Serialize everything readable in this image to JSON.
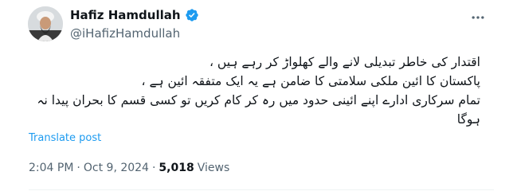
{
  "author": {
    "display_name": "Hafiz Hamdullah",
    "handle": "@iHafizHamdullah",
    "verified_icon": "verified-badge-icon",
    "verified_color": "#1d9bf0"
  },
  "post": {
    "lines": [
      "اقتدار کی خاطر تبدیلی لانے والے کھلواڑ کر رہے ہیں ،",
      "پاکستان کا ائین ملکی سلامتی کا ضامن ہے یہ ایک متفقہ ائین ہے ،",
      "تمام سرکاری ادارے اپنے ائینی حدود میں رہ کر کام کریں تو کسی قسم کا بحران پیدا نہ",
      "ہوگا"
    ],
    "translate_label": "Translate post"
  },
  "meta": {
    "time": "2:04 PM",
    "separator": "·",
    "date": "Oct 9, 2024",
    "views_count": "5,018",
    "views_label": "Views"
  },
  "icons": {
    "more": "more-options-icon"
  },
  "colors": {
    "link": "#1d9bf0",
    "secondary_text": "#536471",
    "primary_text": "#0f1419"
  }
}
